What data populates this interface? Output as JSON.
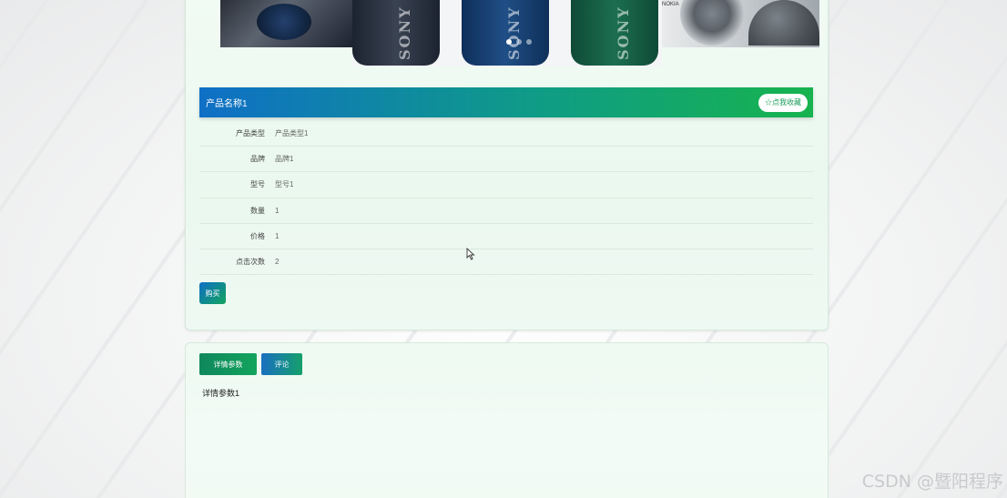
{
  "carousel": {
    "slides": [
      "speaker-remote",
      "sony-speakers",
      "speaker-dome"
    ],
    "speaker_brand": "SONY",
    "right_slide_brand": "NOKIA",
    "active_dot": 0,
    "dot_count": 3
  },
  "product": {
    "name": "产品名称1",
    "favorite_label": "☆点我收藏",
    "fields": [
      {
        "label": "产品类型",
        "value": "产品类型1"
      },
      {
        "label": "品牌",
        "value": "品牌1"
      },
      {
        "label": "型号",
        "value": "型号1"
      },
      {
        "label": "数量",
        "value": "1"
      },
      {
        "label": "价格",
        "value": "1"
      },
      {
        "label": "点击次数",
        "value": "2"
      }
    ],
    "buy_label": "购买"
  },
  "tabs": {
    "details_label": "详情参数",
    "comments_label": "评论"
  },
  "details": {
    "content": "详情参数1"
  },
  "watermark": "CSDN @暨阳程序",
  "colors": {
    "title_gradient_start": "#0f6fc6",
    "title_gradient_end": "#17b34e",
    "accent_green": "#12a45d"
  }
}
